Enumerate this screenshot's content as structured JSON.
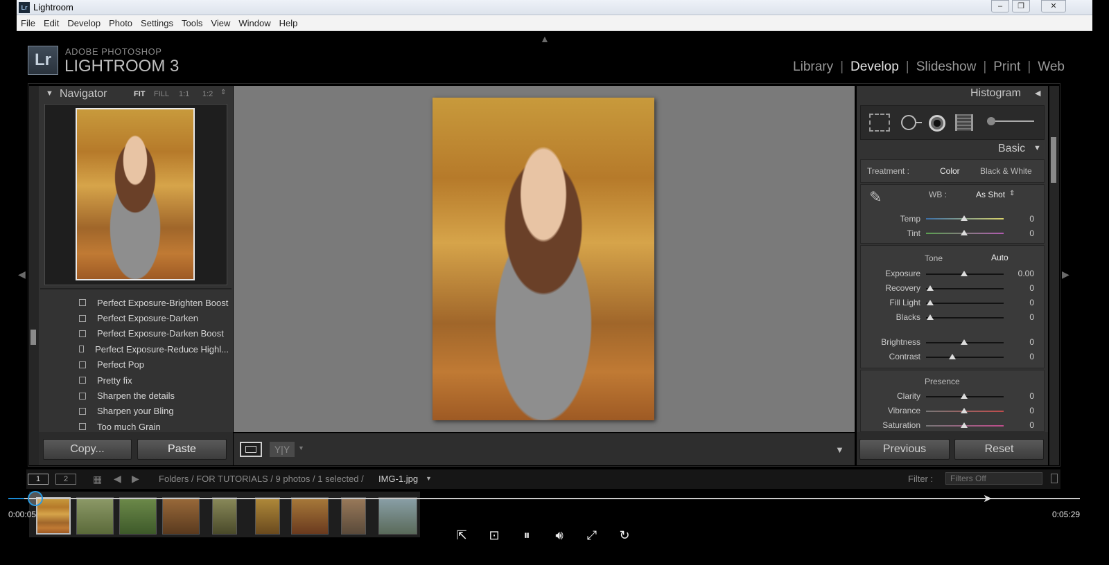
{
  "window": {
    "title": "Lightroom"
  },
  "menu": [
    "File",
    "Edit",
    "Develop",
    "Photo",
    "Settings",
    "Tools",
    "View",
    "Window",
    "Help"
  ],
  "brand": {
    "logo": "Lr",
    "line1": "ADOBE PHOTOSHOP",
    "line2": "LIGHTROOM 3"
  },
  "modules": [
    "Library",
    "Develop",
    "Slideshow",
    "Print",
    "Web"
  ],
  "active_module": "Develop",
  "navigator": {
    "title": "Navigator",
    "zoom": [
      "FIT",
      "FILL",
      "1:1",
      "1:2"
    ]
  },
  "presets": [
    "Perfect Exposure-Brighten Boost",
    "Perfect Exposure-Darken",
    "Perfect Exposure-Darken Boost",
    "Perfect Exposure-Reduce Highl...",
    "Perfect Pop",
    "Pretty fix",
    "Sharpen the details",
    "Sharpen your Bling",
    "Too much Grain"
  ],
  "left_buttons": {
    "copy": "Copy...",
    "paste": "Paste"
  },
  "histogram": {
    "title": "Histogram"
  },
  "basic": {
    "title": "Basic",
    "treatment_label": "Treatment :",
    "treatment_color": "Color",
    "treatment_bw": "Black & White",
    "wb_label": "WB :",
    "wb_value": "As Shot",
    "temp": {
      "label": "Temp",
      "value": "0"
    },
    "tint": {
      "label": "Tint",
      "value": "0"
    },
    "tone_label": "Tone",
    "auto_label": "Auto",
    "exposure": {
      "label": "Exposure",
      "value": "0.00"
    },
    "recovery": {
      "label": "Recovery",
      "value": "0"
    },
    "fill_light": {
      "label": "Fill Light",
      "value": "0"
    },
    "blacks": {
      "label": "Blacks",
      "value": "0"
    },
    "brightness": {
      "label": "Brightness",
      "value": "0"
    },
    "contrast": {
      "label": "Contrast",
      "value": "0"
    },
    "presence_label": "Presence",
    "clarity": {
      "label": "Clarity",
      "value": "0"
    },
    "vibrance": {
      "label": "Vibrance",
      "value": "0"
    },
    "saturation": {
      "label": "Saturation",
      "value": "0"
    }
  },
  "right_buttons": {
    "previous": "Previous",
    "reset": "Reset"
  },
  "filmstrip": {
    "page1": "1",
    "page2": "2",
    "path_prefix": "Folders / FOR TUTORIALS / 9 photos / 1 selected /",
    "file": "IMG-1.jpg",
    "filter_label": "Filter :",
    "filter_value": "Filters Off"
  },
  "video": {
    "current": "0:00:05",
    "total": "0:05:29",
    "progress": 0.015
  }
}
